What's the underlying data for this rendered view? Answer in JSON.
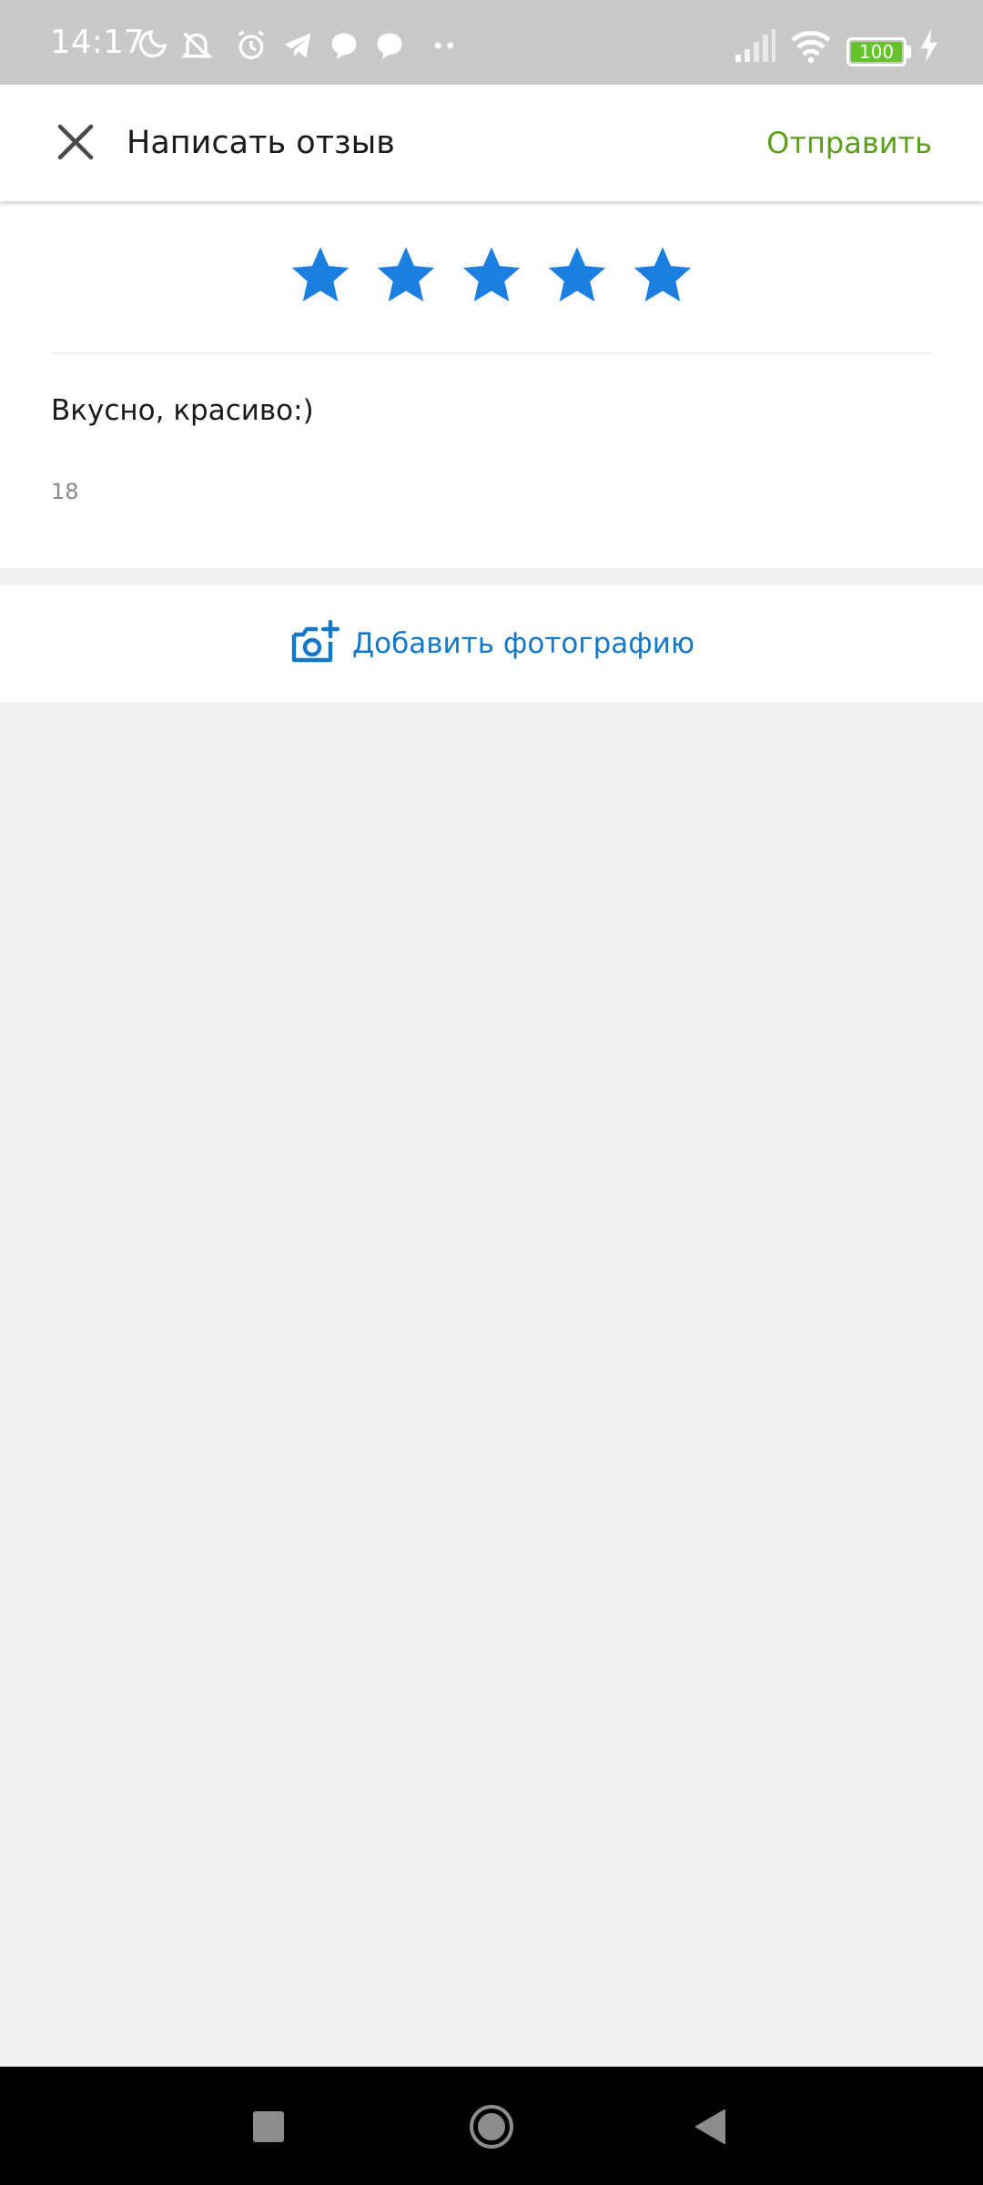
{
  "status_bar": {
    "time": "14:17",
    "battery_level": "100",
    "icons": [
      "moon-icon",
      "muted-bell-icon",
      "alarm-icon",
      "telegram-icon",
      "chat-bubble-icon",
      "chat-bubble-icon",
      "more-dots-icon",
      "signal-icon",
      "wifi-icon",
      "battery-icon",
      "charging-icon"
    ]
  },
  "app_bar": {
    "title": "Написать отзыв",
    "send_label": "Отправить",
    "close_icon": "close-icon"
  },
  "review": {
    "rating": 5,
    "max_rating": 5,
    "star_color": "#1a7fe0",
    "text": "Вкусно, красиво:)",
    "char_count": "18"
  },
  "add_photo": {
    "label": "Добавить фотографию",
    "icon": "add-photo-camera-icon"
  },
  "colors": {
    "accent_green": "#5aa016",
    "link_blue": "#1478c8"
  }
}
